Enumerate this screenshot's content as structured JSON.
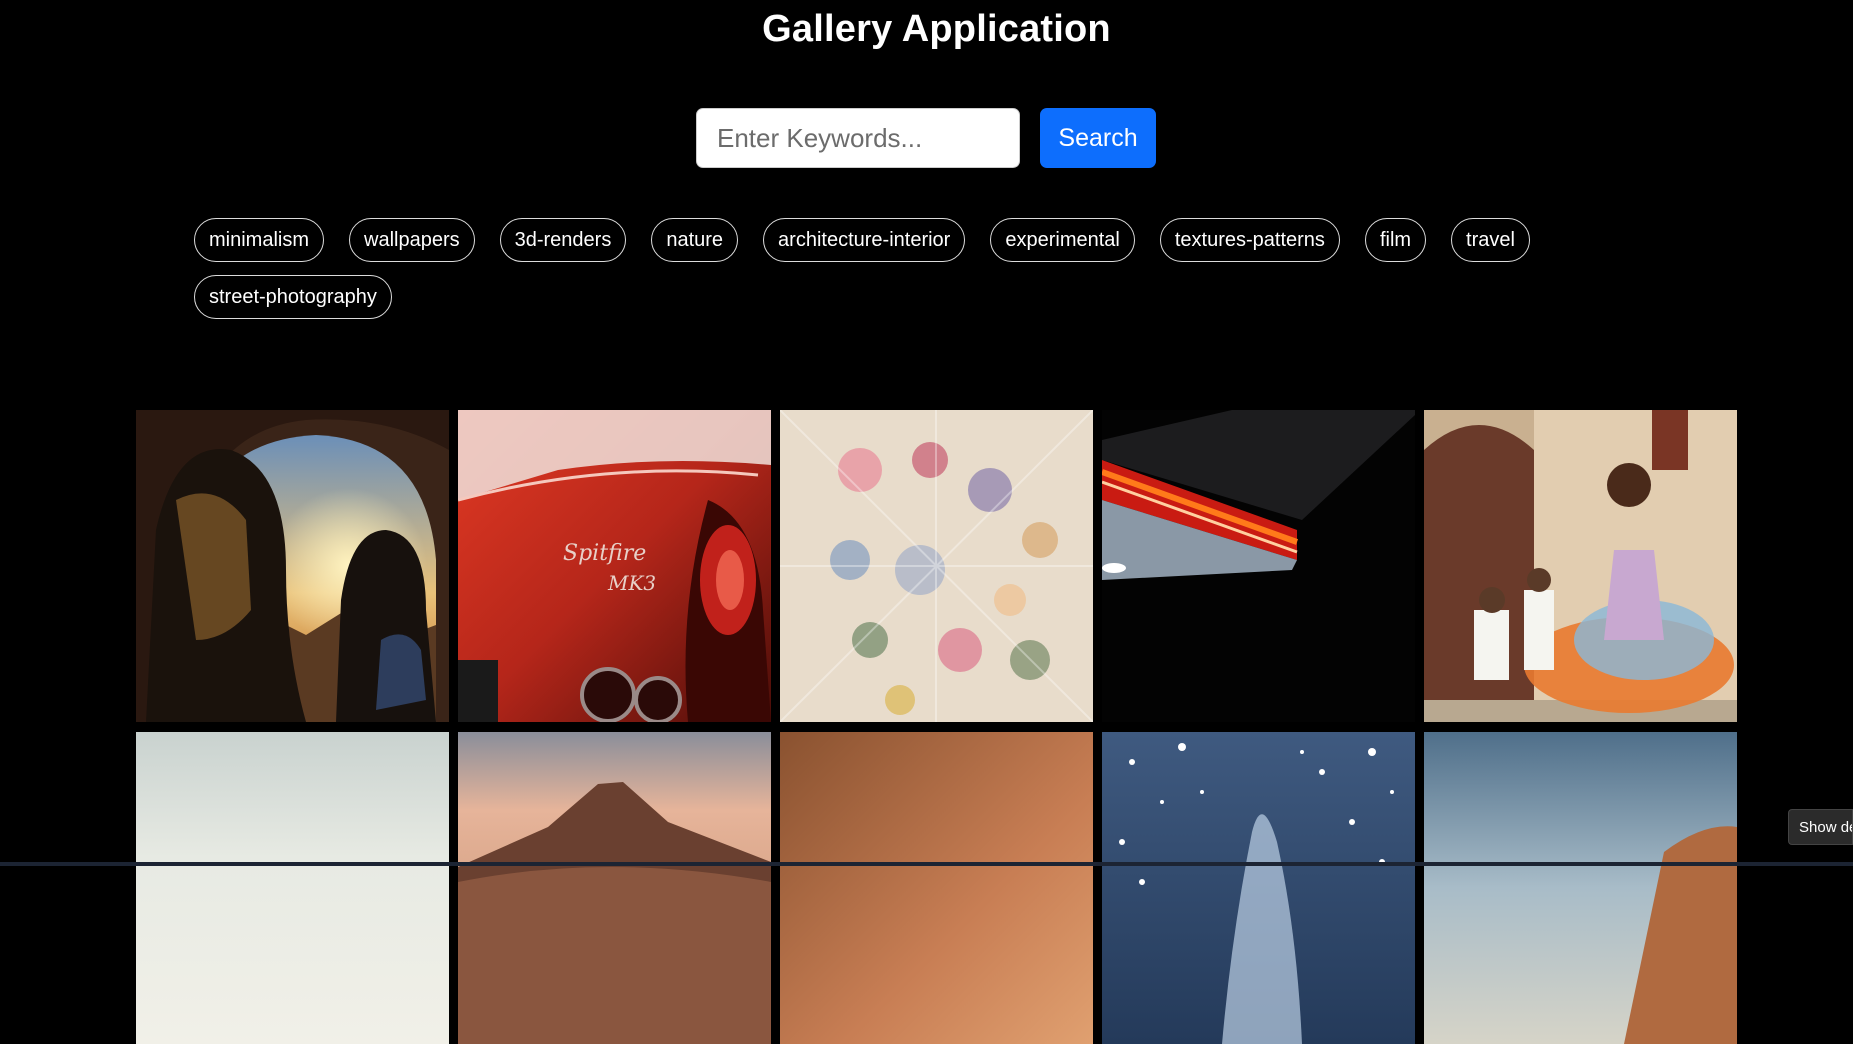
{
  "header": {
    "title": "Gallery Application"
  },
  "search": {
    "placeholder": "Enter Keywords...",
    "value": "",
    "button_label": "Search"
  },
  "tags": [
    "minimalism",
    "wallpapers",
    "3d-renders",
    "nature",
    "architecture-interior",
    "experimental",
    "textures-patterns",
    "film",
    "travel",
    "street-photography"
  ],
  "gallery": {
    "photos": [
      {
        "subject": "two women in a rock arch at sunset"
      },
      {
        "subject": "red sports car rear with Spitfire MK3 badge"
      },
      {
        "subject": "colorful flowers frozen in ice"
      },
      {
        "subject": "gas station canopy at night"
      },
      {
        "subject": "woman dancing in colorful dress"
      },
      {
        "subject": "pale hazy sky"
      },
      {
        "subject": "mountain peak at sunset"
      },
      {
        "subject": "orange gradient sky"
      },
      {
        "subject": "snowy winter scene"
      },
      {
        "subject": "desert horizon under blue sky"
      }
    ]
  },
  "floating": {
    "details_label": "Show de"
  }
}
